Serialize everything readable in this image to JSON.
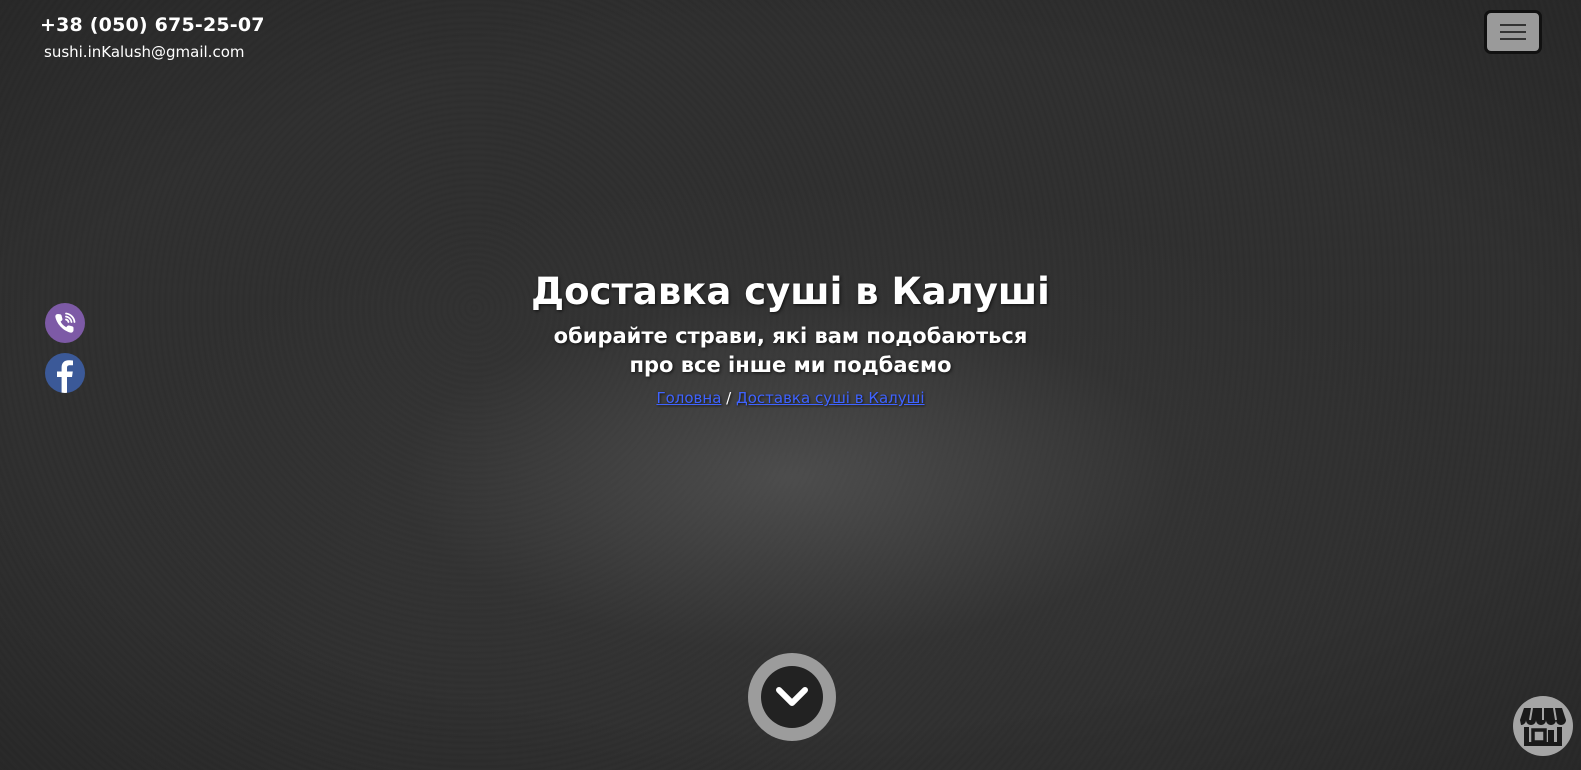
{
  "header": {
    "phone": "+38 (050) 675-25-07",
    "email": "sushi.inKalush@gmail.com",
    "menu_icon": "hamburger-icon"
  },
  "social": {
    "items": [
      {
        "name": "Viber",
        "icon": "viber-icon",
        "color": "#7d5aa6"
      },
      {
        "name": "Facebook",
        "icon": "facebook-icon",
        "color": "#3b5998"
      }
    ]
  },
  "hero": {
    "title": "Доставка суші в Калуші",
    "subtitle_line1": "обирайте страви, які вам подобаються",
    "subtitle_line2": "про все інше ми подбаємо"
  },
  "breadcrumb": {
    "home": "Головна",
    "separator": "/",
    "current": "Доставка суші в Калуші",
    "link_color": "#3f63ff"
  },
  "controls": {
    "scroll_down_icon": "chevron-down-icon",
    "shop_icon": "store-icon"
  }
}
